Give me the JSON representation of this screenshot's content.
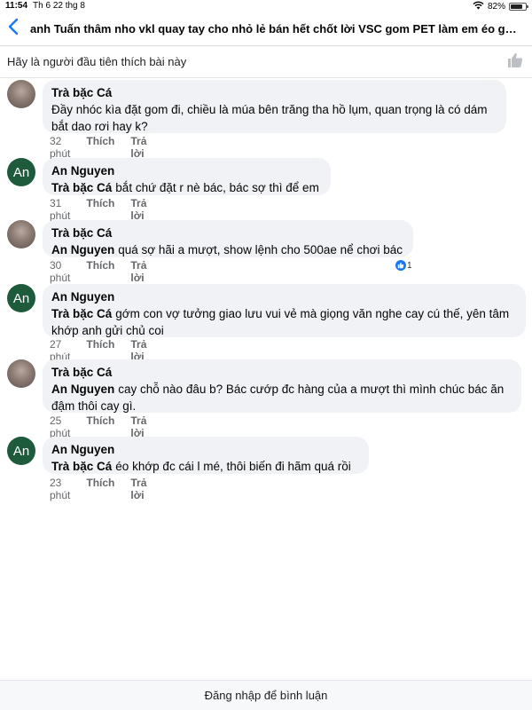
{
  "status": {
    "time": "11:54",
    "date": "Th 6 22 thg 8",
    "battery": "82%",
    "battery_level": 0.82
  },
  "header": {
    "title": "anh Tuấn thâm nho vkl quay tay cho nhỏ lẻ bán hết chốt lời VSC gom PET làm em éo gom đc..."
  },
  "likebar": {
    "text": "Hãy là người đầu tiên thích bài này"
  },
  "actions": {
    "like": "Thích",
    "reply": "Trả lời"
  },
  "comments": [
    {
      "author": "Trà bặc Cá",
      "mention": "",
      "text": "Đầy nhóc kìa đặt gom đi, chiều là múa bên trăng tha hồ lụm, quan trọng là có dám bắt dao rơi hay k?",
      "time": "32 phút"
    },
    {
      "author": "An Nguyen",
      "avatar_text": "An",
      "mention": "Trà bặc Cá",
      "text": "bắt chứ đặt r nè bác, bác sợ thì để em",
      "time": "31 phút"
    },
    {
      "author": "Trà bặc Cá",
      "mention": "An Nguyen",
      "text": "quá sợ hãi a mượt, show lệnh cho 500ae nể chơi bác",
      "time": "30 phút",
      "reaction_count": "1"
    },
    {
      "author": "An Nguyen",
      "avatar_text": "An",
      "mention": "Trà bặc Cá",
      "text": "gớm con vợ tưởng giao lưu vui vẻ mà giọng văn nghe cay cú thế, yên tâm khớp anh gửi chủ coi",
      "time": "27 phút"
    },
    {
      "author": "Trà bặc Cá",
      "mention": "An Nguyen",
      "text": "cay chỗ nào đâu b? Bác cướp đc hàng của a mượt thì mình chúc bác ăn đậm thôi cay gì.",
      "time": "25 phút"
    },
    {
      "author": "An Nguyen",
      "avatar_text": "An",
      "mention": "Trà bặc Cá",
      "text": "éo khớp đc cái l mé, thôi biến đi hãm quá rồi",
      "time": "23 phút"
    }
  ],
  "footer": {
    "text": "Đăng nhập để bình luận"
  },
  "colors": {
    "accent": "#1877f2",
    "avatar_an": "#1e5b3c",
    "bubble": "#f0f2f5"
  }
}
